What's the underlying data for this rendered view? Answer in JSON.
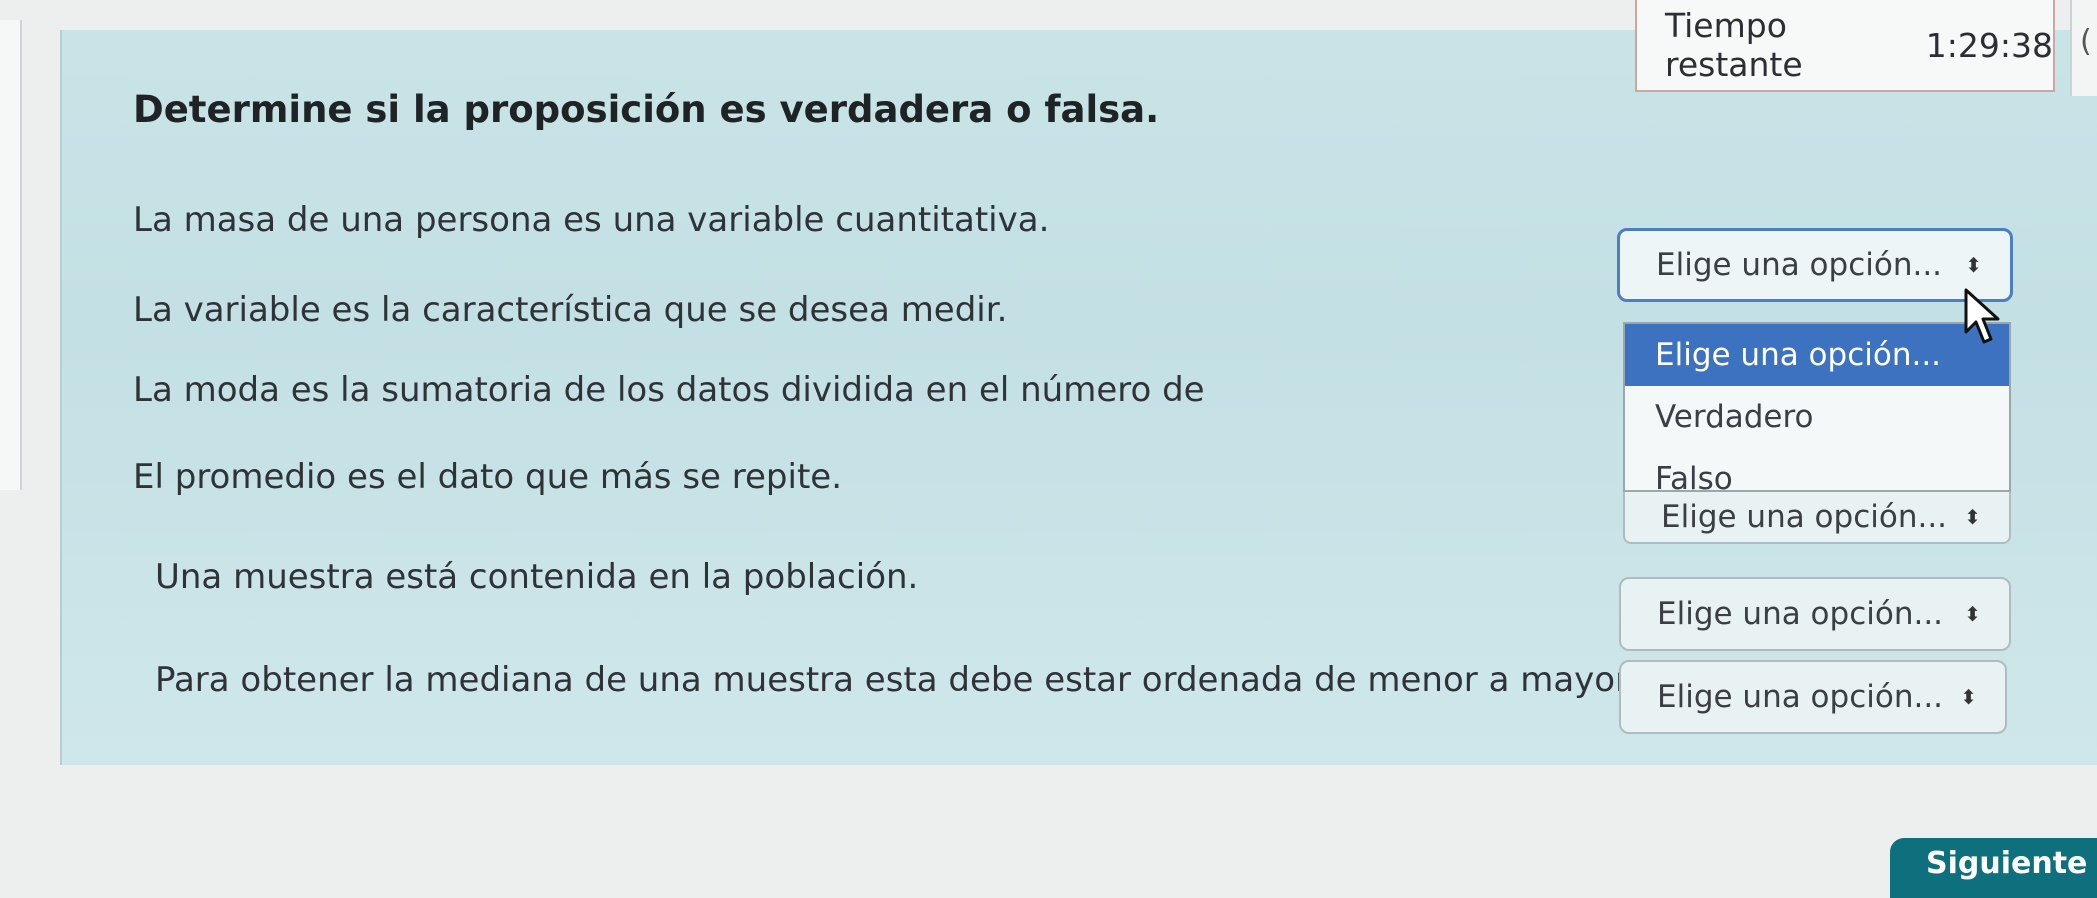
{
  "timer": {
    "label": "Tiempo restante",
    "value": "1:29:38"
  },
  "question": {
    "title": "Determine si la proposición es verdadera o falsa.",
    "statements": [
      "La masa de una persona es una variable cuantitativa.",
      "La variable es la característica que se desea medir.",
      "La moda es la sumatoria de los datos dividida en el número de",
      "El promedio es el dato que más se repite.",
      "Una muestra está contenida en la población.",
      "Para obtener la mediana de una muestra esta debe estar ordenada de menor a mayor"
    ]
  },
  "selects": {
    "placeholder": "Elige una opción...",
    "arrow": "⬍"
  },
  "dropdown": {
    "options": [
      "Elige una opción...",
      "Verdadero",
      "Falso"
    ],
    "selected": "Elige una opción..."
  },
  "side_tab": {
    "glyph": "("
  },
  "next_button": {
    "label": "Siguiente"
  },
  "colors": {
    "panel": "#c9e4e7",
    "dropdown_highlight": "#3d72c0",
    "active_border": "#4b7fc2",
    "next_button": "#0e6f7d",
    "timer_border": "#d2a3a3"
  }
}
